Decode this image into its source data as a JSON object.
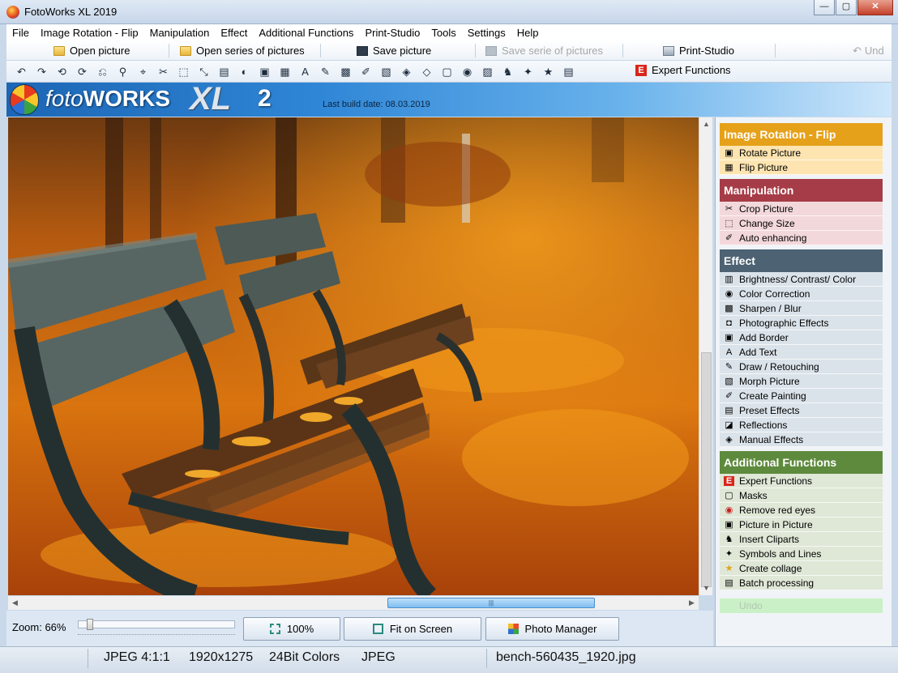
{
  "window": {
    "title": "FotoWorks XL 2019",
    "buttons": [
      "—",
      "▢",
      "✕"
    ]
  },
  "menu": [
    "File",
    "Image Rotation - Flip",
    "Manipulation",
    "Effect",
    "Additional Functions",
    "Print-Studio",
    "Tools",
    "Settings",
    "Help"
  ],
  "toolbar1": {
    "open_picture": "Open picture",
    "open_series": "Open series of pictures",
    "save_picture": "Save picture",
    "save_serie": "Save serie of pictures",
    "print_studio": "Print-Studio",
    "undo": "Und"
  },
  "toolbar2": {
    "icons": [
      "↶",
      "↷",
      "⟲",
      "⟳",
      "⎌",
      "⚲",
      "⌖",
      "✂",
      "⬚",
      "⤡",
      "▤",
      "◐",
      "▣",
      "▦",
      "A",
      "✎",
      "▩",
      "✐",
      "▧",
      "◈",
      "◇",
      "▢",
      "◉",
      "▨",
      "♞",
      "✦",
      "★",
      "▤"
    ],
    "expert_label": "Expert Functions",
    "expert_badge": "E"
  },
  "banner": {
    "brand_prefix": "foto",
    "brand_main": "WORKS",
    "brand_xl": "XL",
    "brand_num": "2",
    "build_date": "Last build date: 08.03.2019"
  },
  "panel": {
    "rotation": {
      "title": "Image Rotation - Flip",
      "color": "#e6a11a",
      "item_bg": "#fde4b0",
      "items": [
        {
          "label": "Rotate Picture",
          "icon": "▣"
        },
        {
          "label": "Flip Picture",
          "icon": "▦"
        }
      ]
    },
    "manipulation": {
      "title": "Manipulation",
      "color": "#a63c47",
      "item_bg": "#f3d8db",
      "items": [
        {
          "label": "Crop Picture",
          "icon": "✂"
        },
        {
          "label": "Change Size",
          "icon": "⬚"
        },
        {
          "label": "Auto enhancing",
          "icon": "✐"
        }
      ]
    },
    "effect": {
      "title": "Effect",
      "color": "#4d6272",
      "item_bg": "#dbe3ea",
      "items": [
        {
          "label": "Brightness/ Contrast/ Color",
          "icon": "▥"
        },
        {
          "label": "Color Correction",
          "icon": "◉"
        },
        {
          "label": "Sharpen / Blur",
          "icon": "▩"
        },
        {
          "label": "Photographic Effects",
          "icon": "◘"
        },
        {
          "label": "Add Border",
          "icon": "▣"
        },
        {
          "label": "Add Text",
          "icon": "A"
        },
        {
          "label": "Draw / Retouching",
          "icon": "✎"
        },
        {
          "label": "Morph Picture",
          "icon": "▧"
        },
        {
          "label": "Create Painting",
          "icon": "✐"
        },
        {
          "label": "Preset Effects",
          "icon": "▤"
        },
        {
          "label": "Reflections",
          "icon": "◪"
        },
        {
          "label": "Manual Effects",
          "icon": "◈"
        }
      ]
    },
    "additional": {
      "title": "Additional Functions",
      "color": "#5d8a3c",
      "item_bg": "#dfe7d7",
      "items": [
        {
          "label": "Expert Functions",
          "icon": "E"
        },
        {
          "label": "Masks",
          "icon": "▢"
        },
        {
          "label": "Remove red eyes",
          "icon": "◉"
        },
        {
          "label": "Picture in Picture",
          "icon": "▣"
        },
        {
          "label": "Insert Cliparts",
          "icon": "♞"
        },
        {
          "label": "Symbols and Lines",
          "icon": "✦"
        },
        {
          "label": "Create collage",
          "icon": "★"
        },
        {
          "label": "Batch processing",
          "icon": "▤"
        }
      ]
    },
    "undo": "Undo"
  },
  "scroll": {
    "up": "▲",
    "down": "▼",
    "left": "◀",
    "right": "▶",
    "grip": "|||"
  },
  "zoom": {
    "label": "Zoom: 66%",
    "level": 0.66
  },
  "buttons": {
    "b100": "100%",
    "fit": "Fit on Screen",
    "manager": "Photo Manager"
  },
  "status": {
    "format": "JPEG  4:1:1",
    "size": "1920x1275",
    "colors": "24Bit Colors",
    "type": "JPEG",
    "filename": "bench-560435_1920.jpg"
  }
}
